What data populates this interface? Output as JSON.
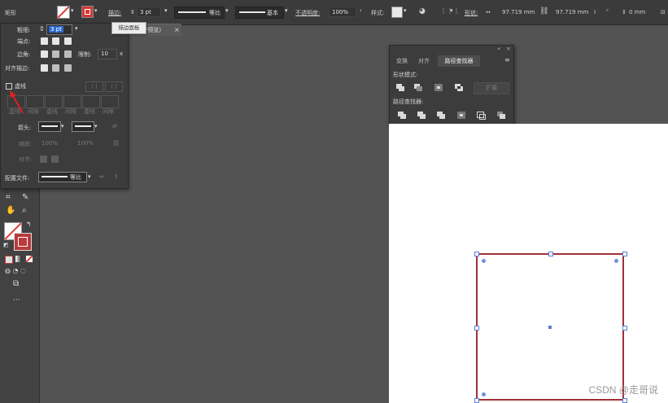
{
  "control_bar": {
    "tool_name": "矩形",
    "stroke_label": "描边:",
    "stroke_value": "3 pt",
    "profile_label": "等比",
    "brush_label": "基本",
    "opacity_label": "不透明度:",
    "opacity_value": "100%",
    "style_label": "样式:",
    "shape_label": "形状:",
    "width_label": "↔",
    "width_value": "97.719 mm",
    "height_value": "97.719 mm",
    "corner_value": "0 mm"
  },
  "tooltip": "描边面板",
  "doc_tab": {
    "title": "/预览)",
    "close": "×"
  },
  "stroke_panel": {
    "weight_label": "粗细:",
    "weight_value": "3 pt",
    "cap_label": "端点:",
    "corner_label": "边角:",
    "limit_label": "限制:",
    "limit_value": "10",
    "limit_unit": "x",
    "align_label": "对齐描边:",
    "dashed_label": "虚线",
    "dash_fields": [
      "虚线",
      "间隙",
      "虚线",
      "间隙",
      "虚线",
      "间隙"
    ],
    "arrow_label": "箭头:",
    "scale_label": "缩放:",
    "scale_value_1": "100%",
    "scale_value_2": "100%",
    "align_arrow_label": "对齐:",
    "profile_label": "配置文件:",
    "profile_value": "等比"
  },
  "pathfinder_panel": {
    "tabs": [
      "变换",
      "对齐",
      "路径查找器"
    ],
    "active_tab": 2,
    "shape_modes_label": "形状模式:",
    "expand_label": "扩展",
    "pathfinders_label": "路径查找器:"
  },
  "toolbar": {
    "more_label": "···"
  },
  "watermark": "CSDN @走哥说",
  "colors": {
    "stroke_color": "#a1303a",
    "accent": "#e03a3a",
    "selection": "#5a7fd0"
  }
}
